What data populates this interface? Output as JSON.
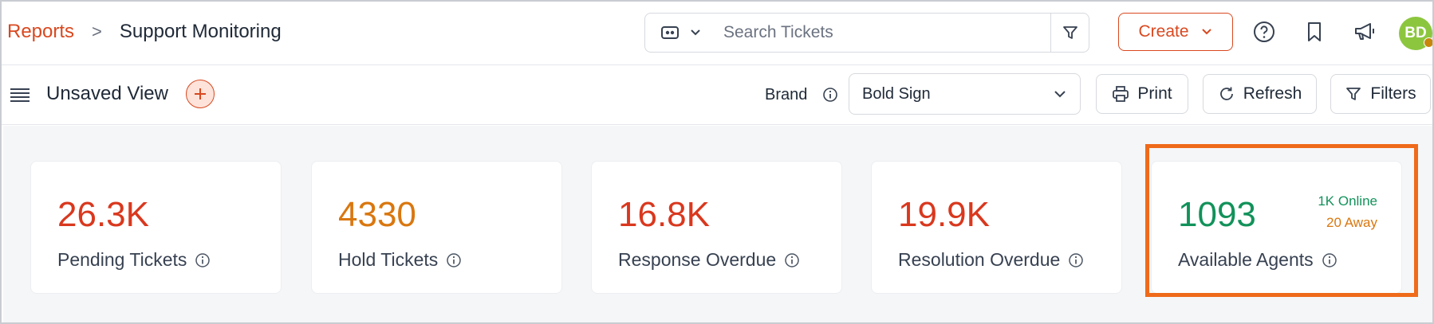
{
  "breadcrumb": {
    "root": "Reports",
    "separator": ">",
    "current": "Support Monitoring"
  },
  "search": {
    "placeholder": "Search Tickets"
  },
  "header": {
    "create_label": "Create",
    "avatar_initials": "BD"
  },
  "toolbar": {
    "view_title": "Unsaved View",
    "brand_label": "Brand",
    "brand_value": "Bold Sign",
    "print_label": "Print",
    "refresh_label": "Refresh",
    "filters_label": "Filters"
  },
  "cards": [
    {
      "value": "26.3K",
      "label": "Pending Tickets",
      "color": "#d9381e"
    },
    {
      "value": "4330",
      "label": "Hold Tickets",
      "color": "#d9770f"
    },
    {
      "value": "16.8K",
      "label": "Response Overdue",
      "color": "#d9381e"
    },
    {
      "value": "19.9K",
      "label": "Resolution Overdue",
      "color": "#d9381e"
    },
    {
      "value": "1093",
      "label": "Available Agents",
      "color": "#12925a",
      "online": "1K Online",
      "away": "20 Away"
    }
  ],
  "colors": {
    "accent": "#d9481f",
    "highlight": "#ef6a1a",
    "online": "#12925a",
    "away": "#d9770f"
  }
}
